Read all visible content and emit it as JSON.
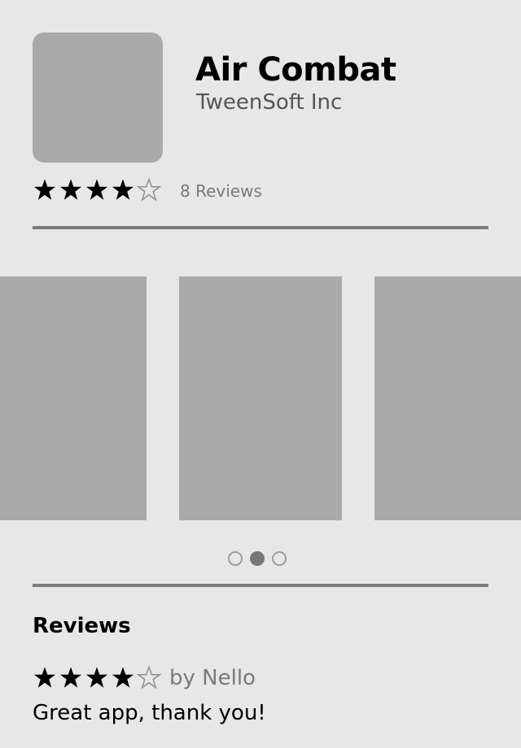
{
  "app": {
    "title": "Air Combat",
    "developer": "TweenSoft Inc",
    "rating": 4,
    "rating_max": 5,
    "review_count_label": "8 Reviews"
  },
  "gallery": {
    "screenshot_count": 3,
    "page_count": 3,
    "active_page": 2
  },
  "reviews": {
    "heading": "Reviews",
    "items": [
      {
        "rating": 4,
        "rating_max": 5,
        "author": "by Nello",
        "text": "Great app, thank you!"
      }
    ]
  },
  "colors": {
    "background": "#e7e7e7",
    "placeholder": "#a9a9a9",
    "divider": "#7b7b7b",
    "star_filled": "#000000",
    "star_empty_stroke": "#8f8f8f"
  },
  "icons": {
    "filled_star": "star-filled-icon",
    "empty_star": "star-empty-icon"
  }
}
